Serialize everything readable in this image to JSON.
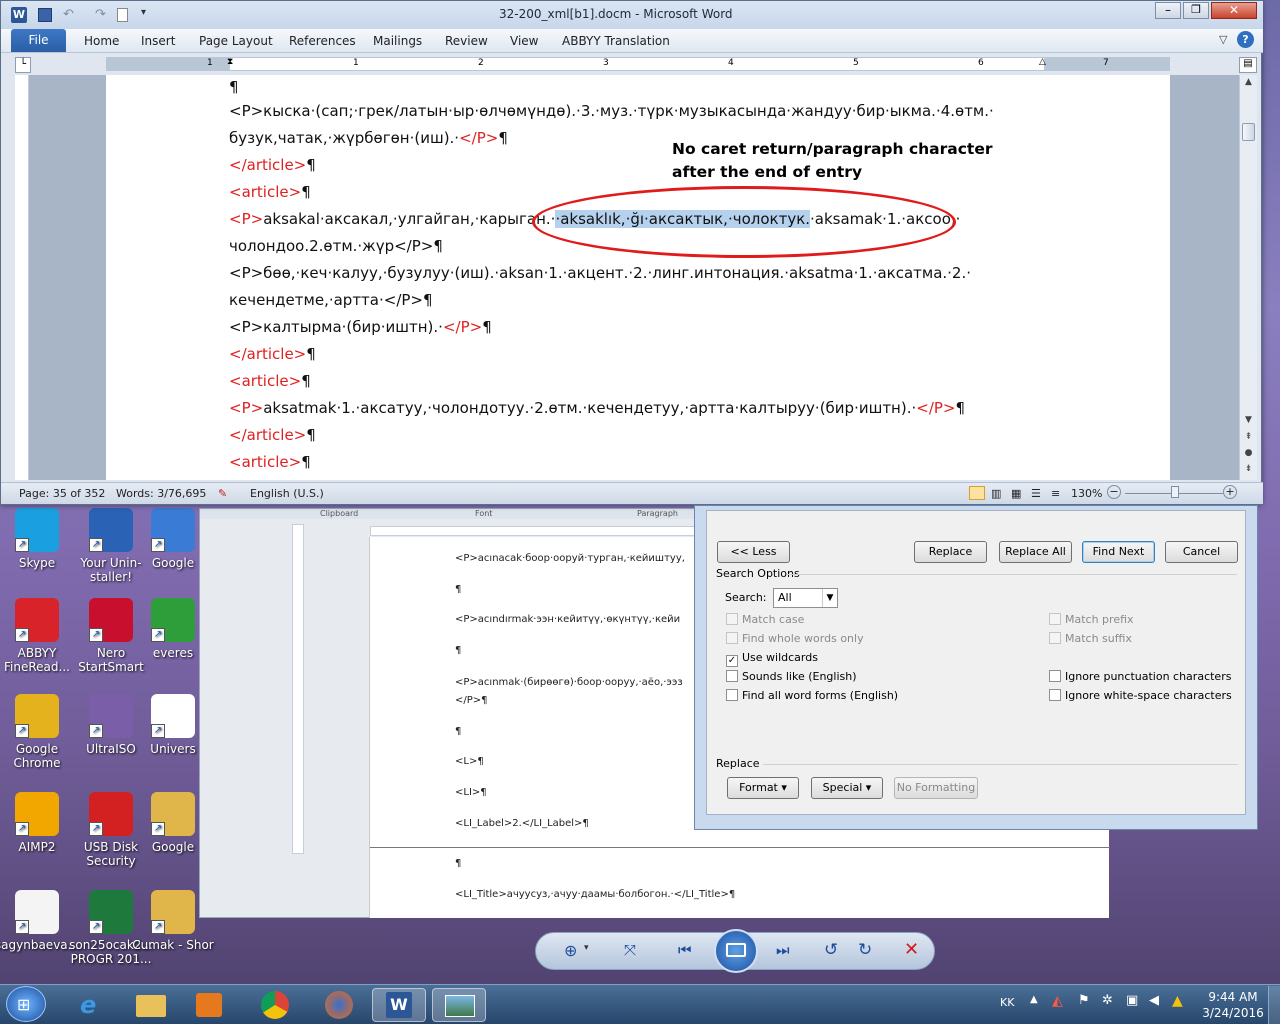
{
  "window": {
    "title": "32-200_xml[b1].docm - Microsoft Word"
  },
  "ribbon": {
    "file": "File",
    "tabs": [
      "Home",
      "Insert",
      "Page Layout",
      "References",
      "Mailings",
      "Review",
      "View",
      "ABBYY Translation"
    ]
  },
  "ruler": {
    "numbers": [
      "1",
      "1",
      "2",
      "3",
      "4",
      "5",
      "6",
      "7"
    ]
  },
  "document": {
    "lines": [
      {
        "parts": [
          {
            "t": "¶",
            "red": false
          }
        ]
      },
      {
        "parts": [
          {
            "t": "<P>кыска·(сап;·грек/латын·ыр·өлчөмүндө).·3.·муз.·түрк·музыкасында·жандуу·бир·ыкма.·4.өтм.·",
            "red": false
          }
        ]
      },
      {
        "parts": [
          {
            "t": "бузук,чатак,·жүрбөгөн·(иш).·",
            "red": false
          },
          {
            "t": "</P>",
            "red": true
          },
          {
            "t": "¶",
            "red": false
          }
        ]
      },
      {
        "parts": [
          {
            "t": "</article>",
            "red": true
          },
          {
            "t": "¶",
            "red": false
          }
        ]
      },
      {
        "parts": [
          {
            "t": "<article>",
            "red": true
          },
          {
            "t": "¶",
            "red": false
          }
        ]
      },
      {
        "parts": [
          {
            "t": "<P>",
            "red": true
          },
          {
            "t": "aksakal·аксакал,·улгайган,·карыган.·",
            "red": false
          },
          {
            "t": "·aksaklık,·ğı·аксактык,·чолоктук.",
            "red": false,
            "hl": true
          },
          {
            "t": "·aksamak·1.·аксоо,·",
            "red": false
          }
        ]
      },
      {
        "parts": [
          {
            "t": "чолондоо.2.өтм.·жүр</P>¶",
            "red": false
          }
        ]
      },
      {
        "parts": [
          {
            "t": "<P>бөө,·кеч·калуу,·бузулуу·(иш).·aksan·1.·акцент.·2.·линг.интонация.·aksatma·1.·аксатма.·2.·",
            "red": false
          }
        ]
      },
      {
        "parts": [
          {
            "t": "кечендетме,·артта·</P>¶",
            "red": false
          }
        ]
      },
      {
        "parts": [
          {
            "t": "<P>калтырма·(бир·иштн).·",
            "red": false
          },
          {
            "t": "</P>",
            "red": true
          },
          {
            "t": "¶",
            "red": false
          }
        ]
      },
      {
        "parts": [
          {
            "t": "</article>",
            "red": true
          },
          {
            "t": "¶",
            "red": false
          }
        ]
      },
      {
        "parts": [
          {
            "t": "<article>",
            "red": true
          },
          {
            "t": "¶",
            "red": false
          }
        ]
      },
      {
        "parts": [
          {
            "t": "<P>",
            "red": true
          },
          {
            "t": "aksatmak·1.·аксатуу,·чолондотуу.·2.өтм.·кечендетуу,·артта·калтыруу·(бир·иштн).·",
            "red": false
          },
          {
            "t": "</P>",
            "red": true
          },
          {
            "t": "¶",
            "red": false
          }
        ]
      },
      {
        "parts": [
          {
            "t": "</article>",
            "red": true
          },
          {
            "t": "¶",
            "red": false
          }
        ]
      },
      {
        "parts": [
          {
            "t": "<article>",
            "red": true
          },
          {
            "t": "¶",
            "red": false
          }
        ]
      }
    ]
  },
  "annotation": {
    "line1": "No caret return/paragraph character",
    "line2": "after the end of entry"
  },
  "status": {
    "page": "Page: 35 of 352",
    "words": "Words: 3/76,695",
    "language": "English (U.S.)",
    "zoom": "130%"
  },
  "background_doc": {
    "groups": [
      "Clipboard",
      "Font",
      "Paragraph"
    ],
    "lines": [
      "<P>acınacak·боор·ооруй·турган,·кейиштуу,",
      "¶",
      "<P>acındırmak·ээн·кейитүү,·өкүнтүү,·кейи",
      "¶",
      "<P>acınmak·(бирөөгө)·боор·ооруу,·аёо,·ээз",
      "</P>¶",
      "¶",
      "<L>¶",
      "<LI>¶",
      "<LI_Label>2.</LI_Label>¶",
      "¶",
      "<LI_Title>ачуусуз,·ачуу·даамы·болбогон.·</LI_Title>¶"
    ]
  },
  "dialog": {
    "less": "<< Less",
    "replace": "Replace",
    "replace_all": "Replace All",
    "find_next": "Find Next",
    "cancel": "Cancel",
    "search_options": "Search Options",
    "search_label": "Search:",
    "search_value": "All",
    "match_case": "Match case",
    "whole_words": "Find whole words only",
    "wildcards": "Use wildcards",
    "sounds_like": "Sounds like (English)",
    "word_forms": "Find all word forms (English)",
    "match_prefix": "Match prefix",
    "match_suffix": "Match suffix",
    "ignore_punct": "Ignore punctuation characters",
    "ignore_space": "Ignore white-space characters",
    "replace_section": "Replace",
    "format": "Format ▾",
    "special": "Special ▾",
    "no_formatting": "No Formatting"
  },
  "desktop_icons": [
    {
      "label": "Skype",
      "color": "#1aa0e0"
    },
    {
      "label": "Your Unin-staller!",
      "color": "#2a62b5"
    },
    {
      "label": "Google",
      "color": "#3a7bd5"
    },
    {
      "label": "ABBYY FineRead...",
      "color": "#d8232a"
    },
    {
      "label": "Nero StartSmart",
      "color": "#c8102e"
    },
    {
      "label": "everes",
      "color": "#2e9e3a"
    },
    {
      "label": "Google Chrome",
      "color": "#e3b21c"
    },
    {
      "label": "UltraISO",
      "color": "#7a5fa8"
    },
    {
      "label": "Univers",
      "color": "#ffffff"
    },
    {
      "label": "AIMP2",
      "color": "#f2a700"
    },
    {
      "label": "USB Disk Security",
      "color": "#d32020"
    },
    {
      "label": "Google",
      "color": "#e0b64a"
    },
    {
      "label": "sagynbaeva...",
      "color": "#f4f4f4"
    },
    {
      "label": "son25ocak2... PROGR 201...",
      "color": "#1e7a3c"
    },
    {
      "label": "Cumak - Shor",
      "color": "#e0b64a"
    }
  ],
  "tray": {
    "lang": "KK",
    "time": "9:44 AM",
    "date": "3/24/2016"
  }
}
